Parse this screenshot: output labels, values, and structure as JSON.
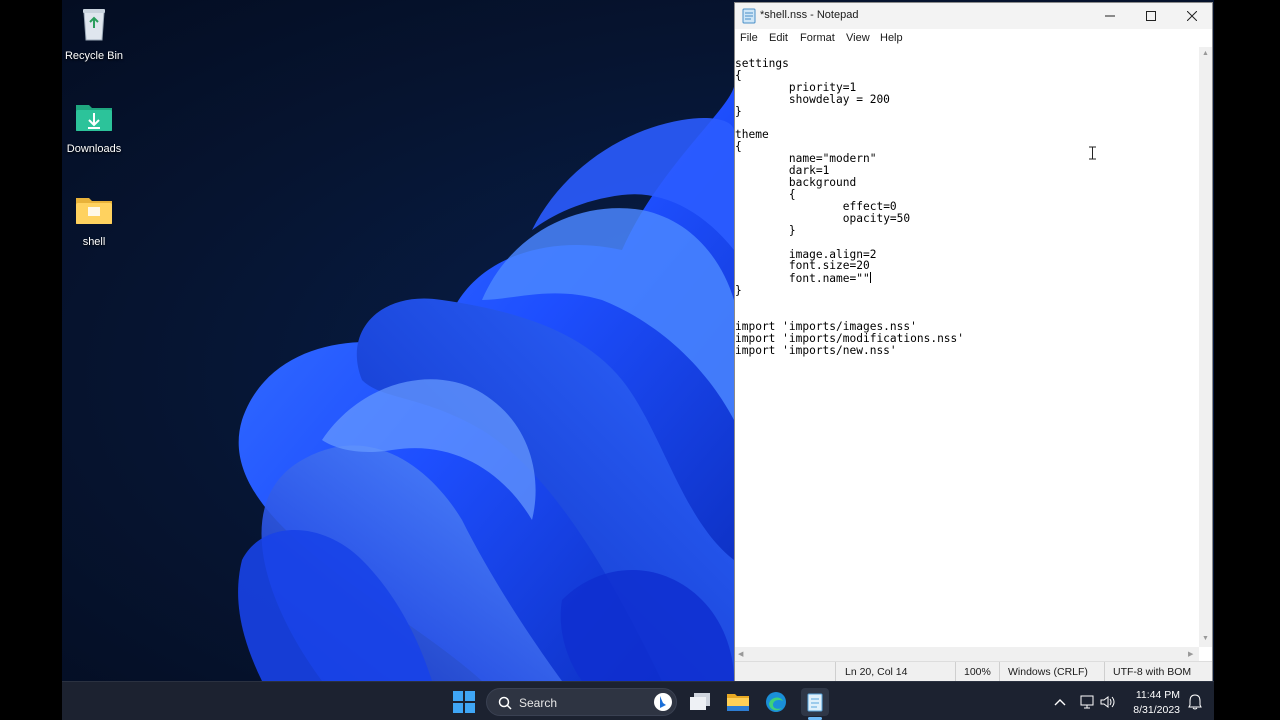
{
  "desktop": {
    "icons": [
      {
        "label": "Recycle Bin",
        "icon": "recycle-bin-icon"
      },
      {
        "label": "Downloads",
        "icon": "downloads-folder-icon"
      },
      {
        "label": "shell",
        "icon": "folder-icon"
      }
    ]
  },
  "notepad": {
    "title": "*shell.nss - Notepad",
    "menu": [
      "File",
      "Edit",
      "Format",
      "View",
      "Help"
    ],
    "content": "settings\n{\n\tpriority=1\n\tshowdelay = 200\n}\n\ntheme\n{\n\tname=\"modern\"\n\tdark=1\n\tbackground\n\t{\n\t\teffect=0\n\t\topacity=50\n\t}\n\n\timage.align=2\n\tfont.size=20\n\tfont.name=\"\"",
    "content_tail": "\n}\n\n\nimport 'imports/images.nss'\nimport 'imports/modifications.nss'\nimport 'imports/new.nss'",
    "status": {
      "position": "Ln 20, Col 14",
      "zoom": "100%",
      "line_ending": "Windows (CRLF)",
      "encoding": "UTF-8 with BOM"
    }
  },
  "taskbar": {
    "search_label": "Search",
    "apps": [
      "start-icon",
      "task-view-icon",
      "file-explorer-icon",
      "edge-icon",
      "notepad-icon"
    ],
    "clock": {
      "time": "11:44 PM",
      "date": "8/31/2023"
    }
  },
  "colors": {
    "desktop_bg": "#061430",
    "bloom_blue": "#1e4fff",
    "taskbar_bg": "#1c2230",
    "accent": "#6cb8f6"
  }
}
